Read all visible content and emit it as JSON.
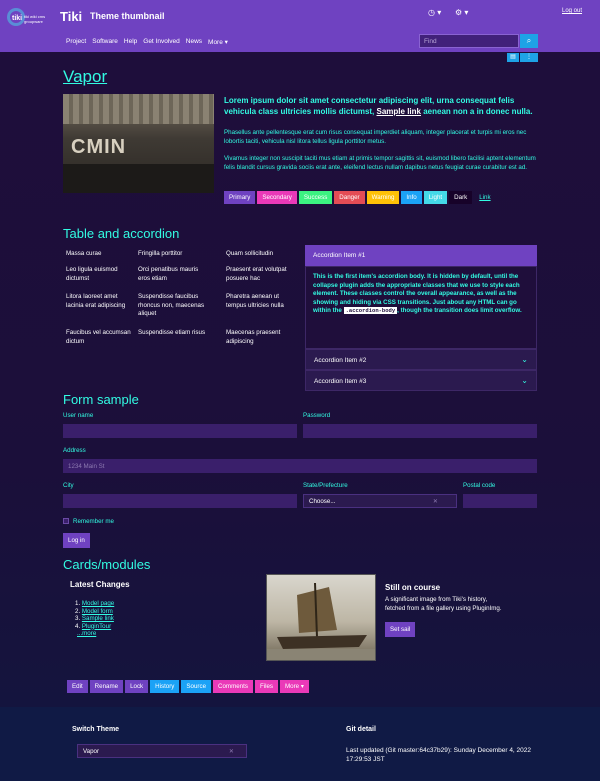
{
  "header": {
    "logo_text": "tiki wiki cms groupware",
    "site_title": "Tiki",
    "site_subtitle": "Theme thumbnail",
    "logout": "Log out",
    "nav": [
      "Project",
      "Software",
      "Help",
      "Get Involved",
      "News",
      "More ▾"
    ],
    "search_placeholder": "Find",
    "icons": [
      "clock-icon",
      "cogs-icon",
      "search-icon"
    ]
  },
  "vapor": {
    "title": "Vapor",
    "photo_sign": "CMIN",
    "lead_pre": "Lorem ipsum dolor sit amet consectetur adipiscing elit, urna consequat felis vehicula class ultricies mollis dictumst,",
    "lead_link": "Sample link",
    "lead_post": "aenean non a in donec nulla.",
    "para1": "Phasellus ante pellentesque erat cum risus consequat imperdiet aliquam, integer placerat et turpis mi eros nec lobortis taciti, vehicula nisl litora tellus ligula porttitor metus.",
    "para2": "Vivamus integer non suscipit taciti mus etiam at primis tempor sagittis sit, euismod libero facilisi aptent elementum felis blandit cursus gravida sociis erat ante, eleifend lectus nullam dapibus netus feugiat curae curabitur est ad.",
    "buttons": [
      {
        "label": "Primary",
        "color": "#6f42c1"
      },
      {
        "label": "Secondary",
        "color": "#ea39b8"
      },
      {
        "label": "Success",
        "color": "#3cf281"
      },
      {
        "label": "Danger",
        "color": "#e44c55"
      },
      {
        "label": "Warning",
        "color": "#ffc107"
      },
      {
        "label": "Info",
        "color": "#1ba2f6"
      },
      {
        "label": "Light",
        "color": "#44d9e8"
      },
      {
        "label": "Dark",
        "color": "#170229"
      },
      {
        "label": "Link",
        "color": "transparent"
      }
    ]
  },
  "table_section": {
    "title": "Table and accordion",
    "rows": [
      [
        "Massa curae",
        "Fringilla porttitor",
        "Quam sollicitudin"
      ],
      [
        "Leo ligula euismod dictumst",
        "Orci penatibus mauris eros etiam",
        "Praesent erat volutpat posuere hac"
      ],
      [
        "Litora laoreet amet lacinia erat adipiscing",
        "Suspendisse faucibus rhoncus non, maecenas aliquet",
        "Pharetra aenean ut tempus ultricies nulla"
      ],
      [
        "Faucibus vel accumsan dictum",
        "Suspendisse etiam risus",
        "Maecenas praesent adipiscing"
      ]
    ],
    "accordion": {
      "item1_title": "Accordion Item #1",
      "item1_body_pre": "This is the first item's accordion body. It is hidden by default, until the collapse plugin adds the appropriate classes that we use to style each element. These classes control the overall appearance, as well as the showing and hiding via CSS transitions. Just about any HTML can go within the",
      "item1_code": ".accordion-body",
      "item1_body_post": ", though the transition does limit overflow.",
      "item2_title": "Accordion Item #2",
      "item3_title": "Accordion Item #3"
    }
  },
  "form": {
    "title": "Form sample",
    "username_label": "User name",
    "password_label": "Password",
    "address_label": "Address",
    "address_placeholder": "1234 Main St",
    "city_label": "City",
    "state_label": "State/Prefecture",
    "state_value": "Choose...",
    "postal_label": "Postal code",
    "remember_label": "Remember me",
    "login_button": "Log in"
  },
  "cards": {
    "title": "Cards/modules",
    "latest_title": "Latest Changes",
    "latest_items": [
      "Model page",
      "Model form",
      "Sample link",
      "PluginTour"
    ],
    "latest_more": "...more",
    "still_title": "Still on course",
    "still_text": "A significant image from Tiki's history, fetched from a file gallery using PluginImg.",
    "set_sail": "Set sail",
    "module_buttons": [
      {
        "label": "Edit",
        "color": "#6f42c1"
      },
      {
        "label": "Rename",
        "color": "#6f42c1"
      },
      {
        "label": "Lock",
        "color": "#6f42c1"
      },
      {
        "label": "History",
        "color": "#1ba2f6"
      },
      {
        "label": "Source",
        "color": "#1ba2f6"
      },
      {
        "label": "Comments",
        "color": "#ea39b8"
      },
      {
        "label": "Files",
        "color": "#ea39b8"
      },
      {
        "label": "More ▾",
        "color": "#ea39b8"
      }
    ]
  },
  "footer": {
    "switch_title": "Switch Theme",
    "theme_value": "Vapor",
    "git_title": "Git detail",
    "git_text": "Last updated (Git master:64c37b29): Sunday December 4, 2022 17:29:53 JST"
  }
}
